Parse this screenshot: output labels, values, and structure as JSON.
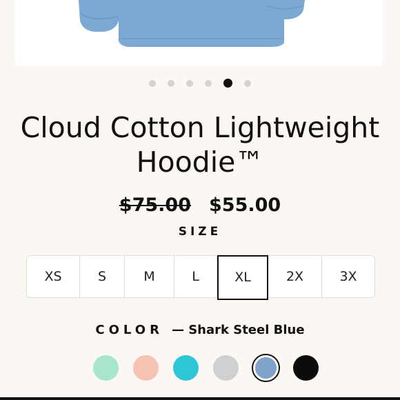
{
  "product": {
    "title": "Cloud Cotton Lightweight Hoodie™",
    "price_original": "$75.00",
    "price_sale": "$55.00"
  },
  "carousel": {
    "count": 6,
    "active_index": 4
  },
  "size": {
    "label": "SIZE",
    "options": [
      "XS",
      "S",
      "M",
      "L",
      "XL",
      "2X",
      "3X"
    ],
    "selected": "XL"
  },
  "color": {
    "label": "COLOR",
    "selected_name": "— Shark Steel Blue",
    "swatches": [
      {
        "name": "mint",
        "hex": "#a7e6cc"
      },
      {
        "name": "peach",
        "hex": "#f6c3b2"
      },
      {
        "name": "turquoise",
        "hex": "#2cc6d6"
      },
      {
        "name": "heather-grey",
        "hex": "#cfd0d1"
      },
      {
        "name": "shark-steel-blue",
        "hex": "#7fa3c9",
        "selected": true
      },
      {
        "name": "black",
        "hex": "#0c0c0c"
      }
    ]
  },
  "colors": {
    "background": "#fbf7f3",
    "hoodie": "#7ca8d4"
  }
}
